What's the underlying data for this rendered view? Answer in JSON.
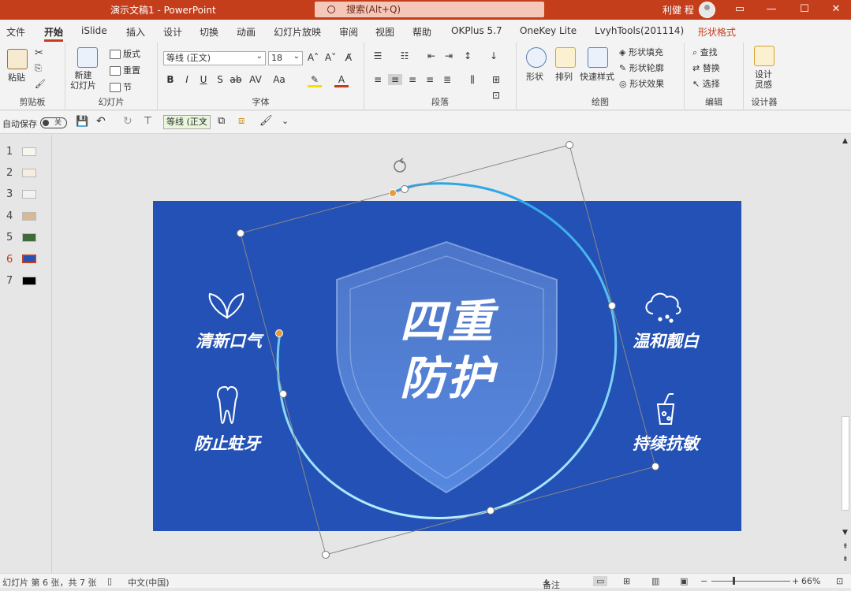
{
  "window": {
    "title": "演示文稿1  -  PowerPoint",
    "search_placeholder": "搜索(Alt+Q)",
    "user": "利健 程"
  },
  "tabs": [
    "文件",
    "开始",
    "iSlide",
    "插入",
    "设计",
    "切换",
    "动画",
    "幻灯片放映",
    "审阅",
    "视图",
    "帮助",
    "OKPlus 5.7",
    "OneKey Lite",
    "LvyhTools(201114)",
    "形状格式"
  ],
  "ribbon": {
    "clipboard": {
      "paste": "粘贴",
      "label": "剪贴板"
    },
    "slides": {
      "new_slide": "新建\n幻灯片",
      "layout": "版式",
      "reset": "重置",
      "section": "节",
      "label": "幻灯片"
    },
    "font": {
      "name": "等线 (正文)",
      "size": "18",
      "label": "字体"
    },
    "paragraph": {
      "label": "段落"
    },
    "drawing": {
      "shape": "形状",
      "arrange": "排列",
      "quick_styles": "快速样式",
      "fill": "形状填充",
      "outline": "形状轮廓",
      "effect": "形状效果",
      "label": "绘图"
    },
    "editing": {
      "find": "查找",
      "replace": "替换",
      "select": "选择",
      "label": "编辑"
    },
    "designer": {
      "button": "设计\n灵感",
      "label": "设计器"
    }
  },
  "qat": {
    "autosave": "自动保存",
    "toggle": "关",
    "font": "等线 (正文"
  },
  "thumbnails": {
    "numbers": [
      "1",
      "2",
      "3",
      "4",
      "5",
      "6",
      "7"
    ],
    "current": "6"
  },
  "slide": {
    "center_title_1": "四重",
    "center_title_2": "防护",
    "features": [
      "清新口气",
      "防止蛀牙",
      "温和靓白",
      "持续抗敏"
    ],
    "colors": {
      "background": "#2351b5",
      "ring": "#7fd9f5",
      "handle": "#e79b3a"
    }
  },
  "status": {
    "slide_info": "幻灯片 第 6 张，共 7 张",
    "language": "中文(中国)",
    "notes": "备注",
    "zoom": "66%"
  }
}
